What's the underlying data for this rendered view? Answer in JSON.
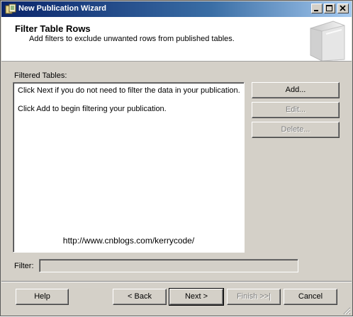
{
  "window": {
    "title": "New Publication Wizard"
  },
  "header": {
    "title": "Filter Table Rows",
    "subtitle": "Add filters to exclude unwanted rows from published tables."
  },
  "filtered_tables": {
    "label": "Filtered Tables:",
    "lines": [
      "Click Next if you do not need to filter the data in your publication.",
      "Click Add to begin filtering your publication."
    ],
    "watermark": "http://www.cnblogs.com/kerrycode/"
  },
  "side_buttons": {
    "add": "Add...",
    "edit": "Edit...",
    "delete": "Delete..."
  },
  "filter": {
    "label": "Filter:",
    "value": ""
  },
  "footer_buttons": {
    "help": "Help",
    "back": "< Back",
    "next": "Next >",
    "finish": "Finish >>|",
    "cancel": "Cancel"
  },
  "icons": {
    "app": "wizard-app-icon",
    "header": "publication-book-graphic"
  },
  "colors": {
    "titlebar_start": "#0a246a",
    "titlebar_end": "#a6caf0",
    "face": "#d4d0c8",
    "disabled_text": "#808080"
  }
}
